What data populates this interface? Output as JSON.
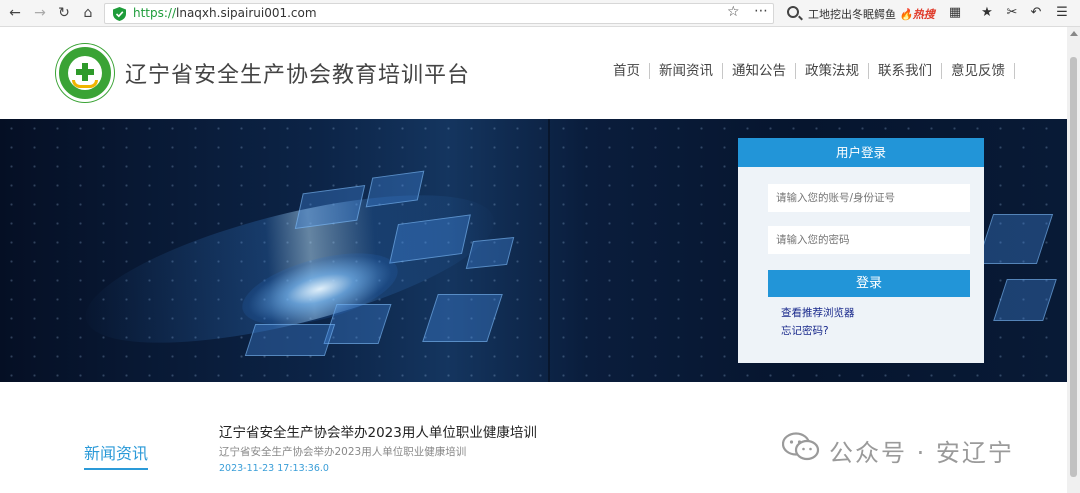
{
  "browser": {
    "url_scheme": "https://",
    "url_host": "lnaqxh.sipairui001.com",
    "search_text": "工地挖出冬眠鳄鱼",
    "hot_label": "热搜"
  },
  "header": {
    "site_title": "辽宁省安全生产协会教育培训平台",
    "nav": [
      "首页",
      "新闻资讯",
      "通知公告",
      "政策法规",
      "联系我们",
      "意见反馈"
    ]
  },
  "login": {
    "title": "用户登录",
    "account_placeholder": "请输入您的账号/身份证号",
    "password_placeholder": "请输入您的密码",
    "submit_label": "登录",
    "browser_link": "查看推荐浏览器",
    "forgot_link": "忘记密码?"
  },
  "news": {
    "section_title": "新闻资讯",
    "item_title": "辽宁省安全生产协会举办2023用人单位职业健康培训",
    "item_summary": "辽宁省安全生产协会举办2023用人单位职业健康培训",
    "item_date": "2023-11-23 17:13:36.0"
  },
  "watermark": {
    "text": "公众号 · 安辽宁"
  },
  "colors": {
    "accent": "#2295d8",
    "logo_green": "#3aa335",
    "banner_dark": "#071631"
  },
  "icons": [
    "back-arrow-icon",
    "forward-arrow-icon",
    "reload-icon",
    "home-icon",
    "shield-icon",
    "star-icon",
    "more-icon",
    "search-icon",
    "grid-icon",
    "bookmark-icon",
    "scissors-icon",
    "undo-icon",
    "menu-icon",
    "wechat-icon"
  ]
}
